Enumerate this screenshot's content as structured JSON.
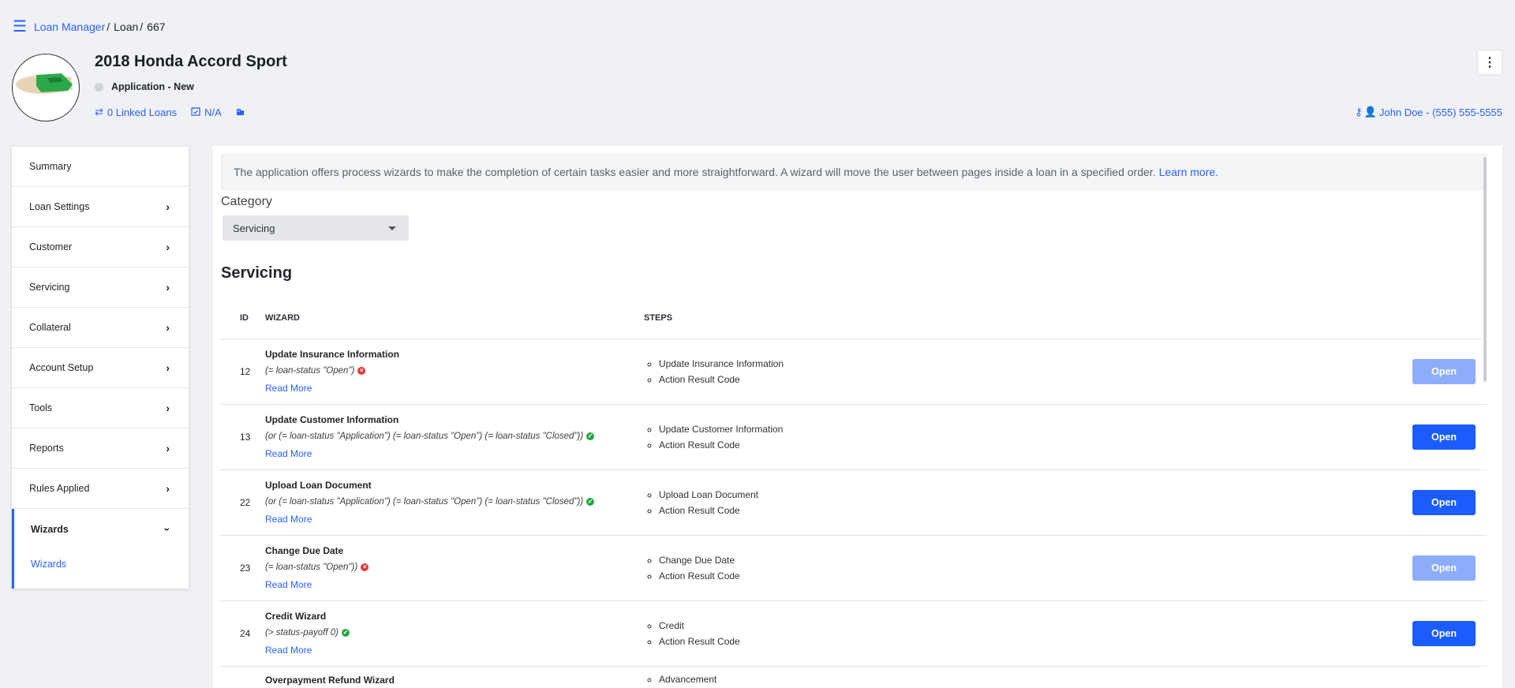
{
  "breadcrumb": {
    "loan_manager": "Loan Manager",
    "loan": "Loan",
    "loan_id": "667"
  },
  "header": {
    "title": "2018 Honda Accord Sport",
    "status": "Application - New",
    "linked_loans": "0 Linked Loans",
    "date_value": "N/A",
    "contact": "John Doe - (555) 555-5555"
  },
  "sidebar": {
    "items": [
      {
        "label": "Summary"
      },
      {
        "label": "Loan Settings"
      },
      {
        "label": "Customer"
      },
      {
        "label": "Servicing"
      },
      {
        "label": "Collateral"
      },
      {
        "label": "Account Setup"
      },
      {
        "label": "Tools"
      },
      {
        "label": "Reports"
      },
      {
        "label": "Rules Applied"
      },
      {
        "label": "Wizards"
      }
    ],
    "sub_item": "Wizards"
  },
  "info": {
    "text": "The application offers process wizards to make the completion of certain tasks easier and more straightforward. A wizard will move the user between pages inside a loan in a specified order.",
    "link": "Learn more."
  },
  "category": {
    "label": "Category",
    "selected": "Servicing"
  },
  "section_title": "Servicing",
  "table": {
    "headers": {
      "id": "ID",
      "wizard": "WIZARD",
      "steps": "STEPS"
    },
    "rows": [
      {
        "id": "12",
        "name": "Update Insurance Information",
        "condition": "(= loan-status \"Open\")",
        "condition_ok": false,
        "read_more": "Read More",
        "steps": [
          "Update Insurance Information",
          "Action Result Code"
        ],
        "action": "Open",
        "enabled": false
      },
      {
        "id": "13",
        "name": "Update Customer Information",
        "condition": "(or (= loan-status \"Application\") (= loan-status \"Open\") (= loan-status \"Closed\"))",
        "condition_ok": true,
        "read_more": "Read More",
        "steps": [
          "Update Customer Information",
          "Action Result Code"
        ],
        "action": "Open",
        "enabled": true
      },
      {
        "id": "22",
        "name": "Upload Loan Document",
        "condition": "(or (= loan-status \"Application\") (= loan-status \"Open\") (= loan-status \"Closed\"))",
        "condition_ok": true,
        "read_more": "Read More",
        "steps": [
          "Upload Loan Document",
          "Action Result Code"
        ],
        "action": "Open",
        "enabled": true
      },
      {
        "id": "23",
        "name": "Change Due Date",
        "condition": "(= loan-status \"Open\"))",
        "condition_ok": false,
        "read_more": "Read More",
        "steps": [
          "Change Due Date",
          "Action Result Code"
        ],
        "action": "Open",
        "enabled": false
      },
      {
        "id": "24",
        "name": "Credit Wizard",
        "condition": "(> status-payoff 0)",
        "condition_ok": true,
        "read_more": "Read More",
        "steps": [
          "Credit",
          "Action Result Code"
        ],
        "action": "Open",
        "enabled": true
      }
    ],
    "partial_row": {
      "name": "Overpayment Refund Wizard",
      "step": "Advancement"
    }
  },
  "colors": {
    "accent": "#2962ff",
    "button": "#1b5cff",
    "button_disabled": "#8dadfb",
    "ok": "#28a745",
    "error": "#e53935"
  }
}
